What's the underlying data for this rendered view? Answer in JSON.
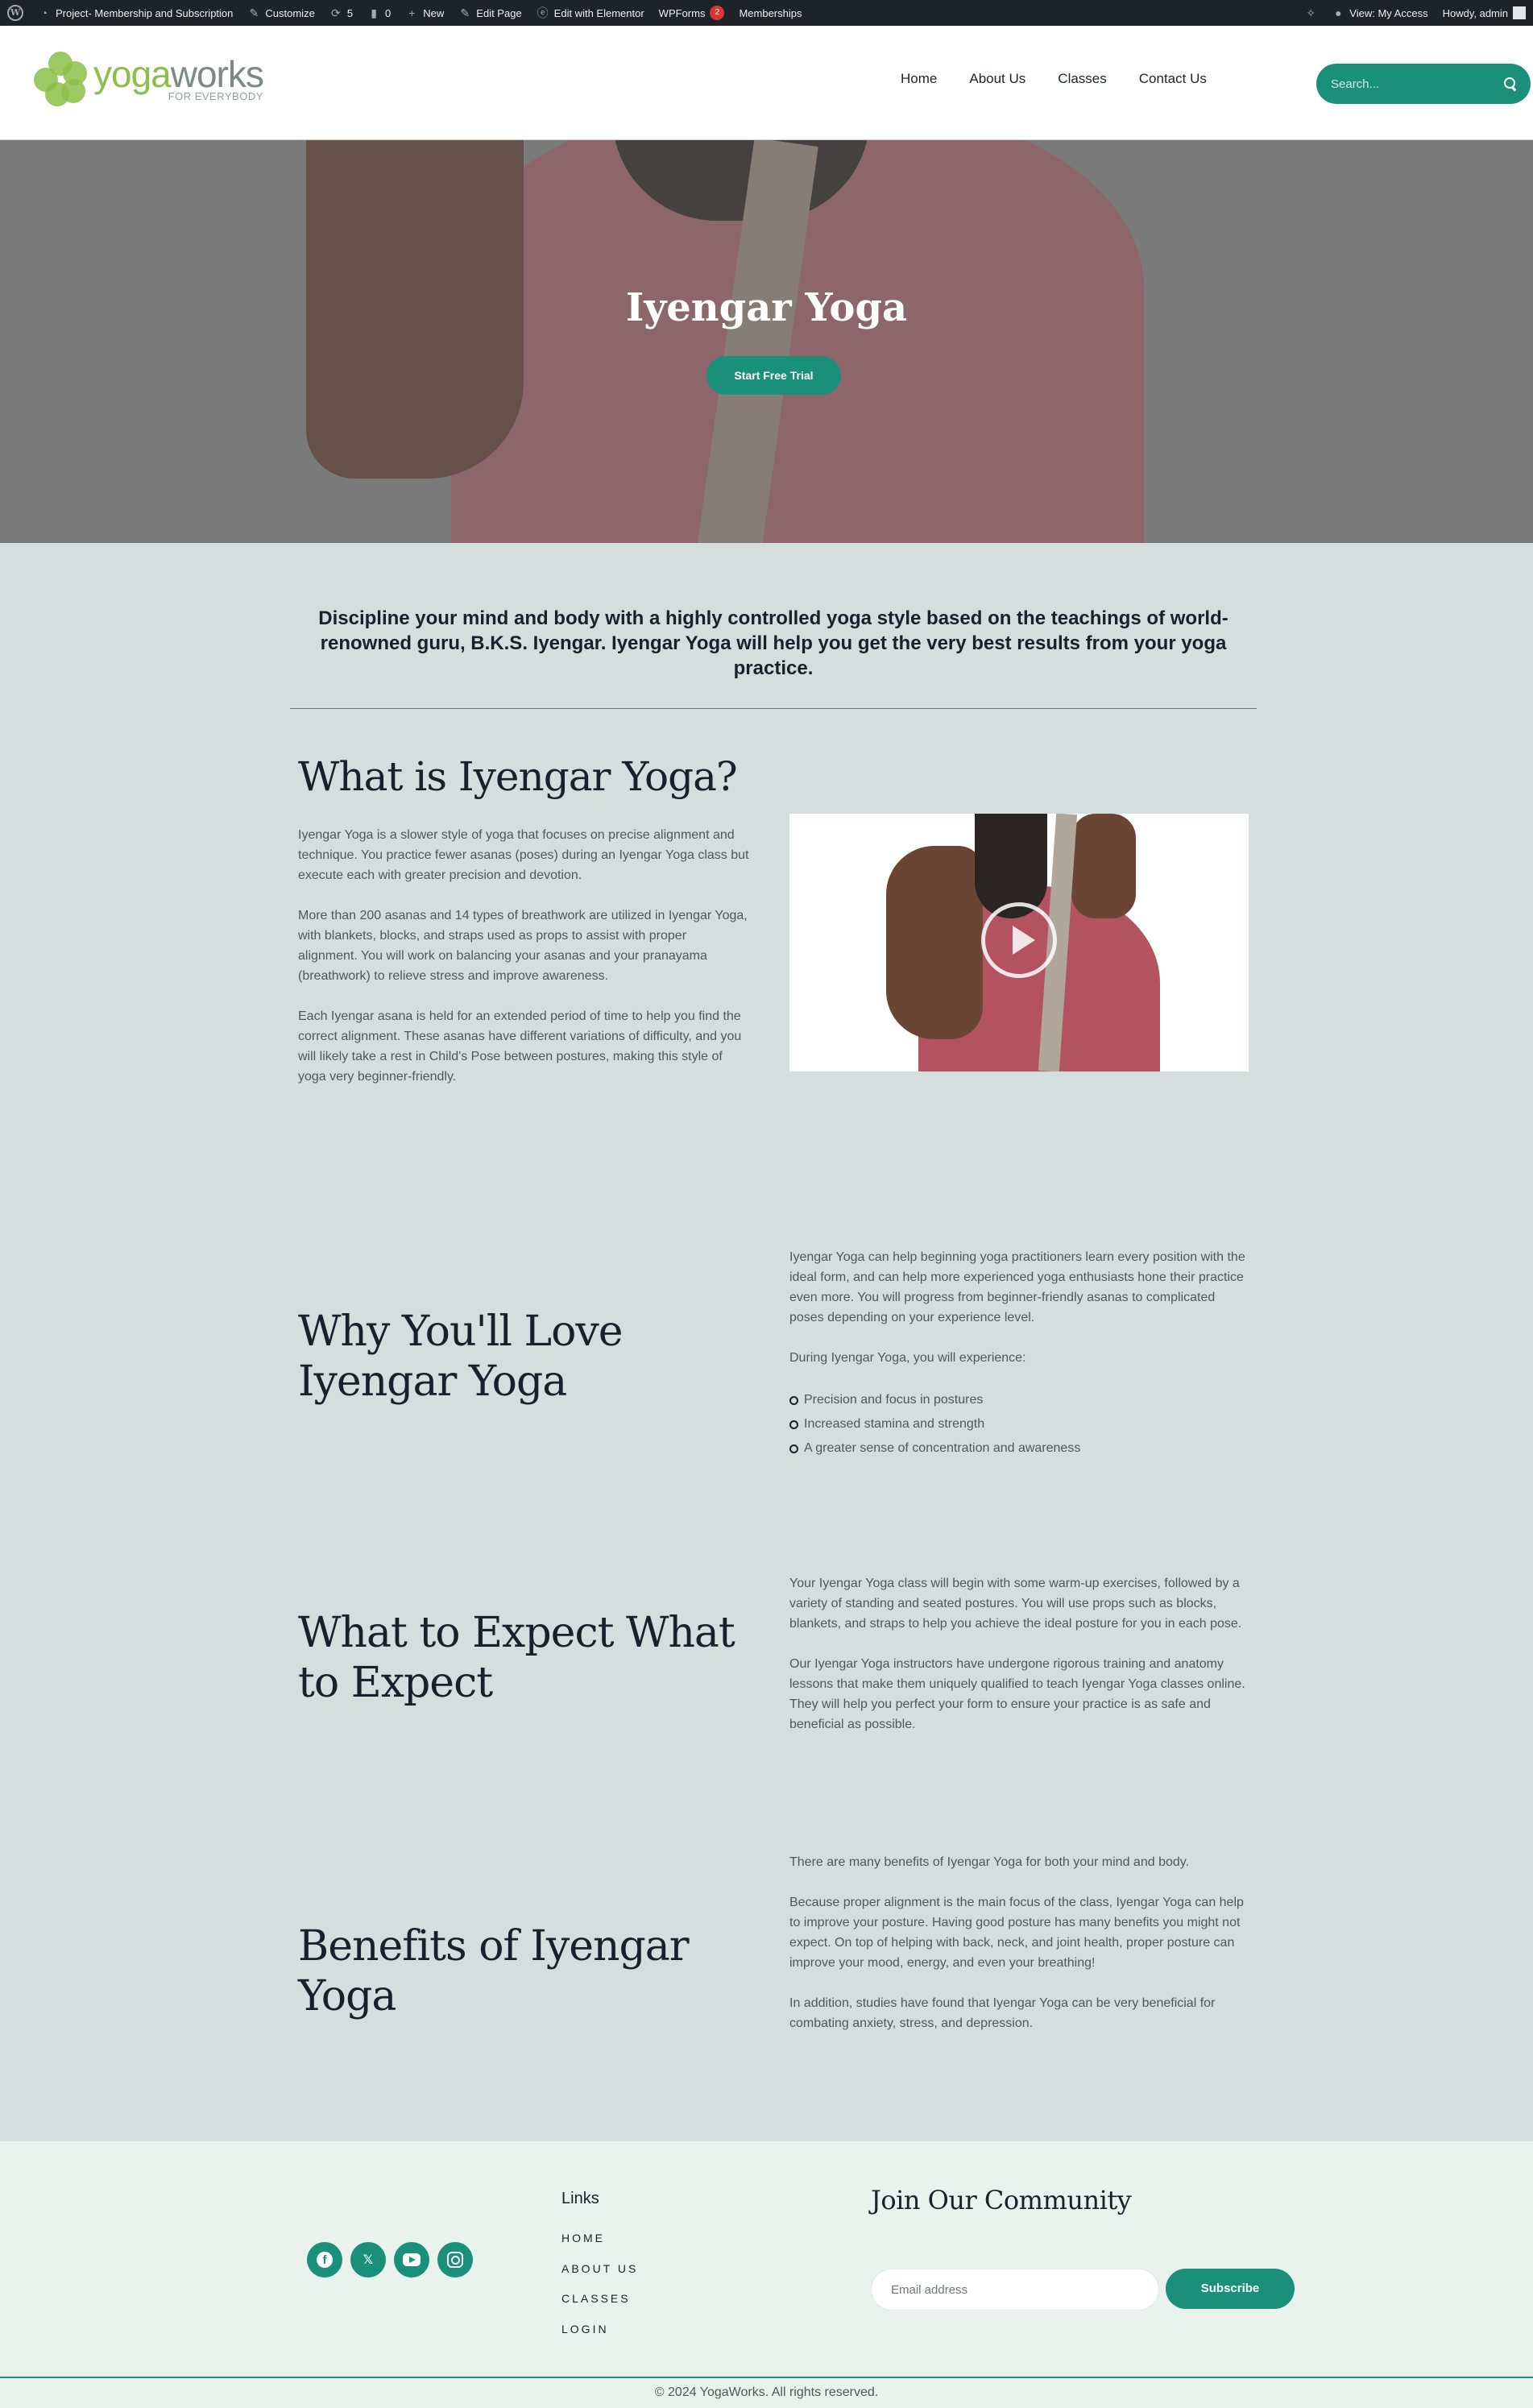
{
  "adminbar": {
    "site_name": "Project- Membership and Subscription",
    "customize": "Customize",
    "updates_count": "5",
    "comments_count": "0",
    "new": "New",
    "edit_page": "Edit Page",
    "edit_elementor": "Edit with Elementor",
    "wpforms": "WPForms",
    "wpforms_badge": "2",
    "memberships": "Memberships",
    "view_access": "View: My Access",
    "howdy": "Howdy, admin"
  },
  "header": {
    "logo_yoga": "yoga",
    "logo_works": "works",
    "logo_sub": "FOR EVERYBODY",
    "nav": [
      "Home",
      "About Us",
      "Classes",
      "Contact Us"
    ],
    "search_placeholder": "Search..."
  },
  "hero": {
    "title": "Iyengar Yoga",
    "cta": "Start Free Trial"
  },
  "intro": "Discipline your mind and body with a highly controlled yoga style based on the teachings of world-renowned guru, B.K.S. Iyengar. Iyengar Yoga will help you get the very best results from your yoga practice.",
  "what": {
    "title": "What is Iyengar Yoga?",
    "paragraphs": [
      "Iyengar Yoga is a slower style of yoga that focuses on precise alignment and technique. You practice fewer asanas (poses) during an Iyengar Yoga class but execute each with greater precision and devotion.",
      "More than 200 asanas and 14 types of breathwork are utilized in Iyengar Yoga, with blankets, blocks, and straps used as props to assist with proper alignment. You will work on balancing your asanas and your pranayama (breathwork) to relieve stress and improve awareness.",
      "Each Iyengar asana is held for an extended period of time to help you find the correct alignment. These asanas have different variations of difficulty, and you will likely take a rest in Child's Pose between postures, making this style of yoga very beginner-friendly."
    ]
  },
  "why": {
    "title": "Why You'll Love Iyengar Yoga",
    "paragraphs": [
      "Iyengar Yoga can help beginning yoga practitioners learn every position with the ideal form, and can help more experienced yoga enthusiasts hone their practice even more. You will progress from beginner-friendly asanas to complicated poses depending on your experience level.",
      "During Iyengar Yoga, you will experience:"
    ],
    "bullets": [
      "Precision and focus in postures",
      "Increased stamina and strength",
      "A greater sense of concentration and awareness"
    ]
  },
  "expect": {
    "title": "What to Expect What to Expect",
    "paragraphs": [
      "Your Iyengar Yoga class will begin with some warm-up exercises, followed by a variety of standing and seated postures. You will use props such as blocks, blankets, and straps to help you achieve the ideal posture for you in each pose.",
      "Our Iyengar Yoga instructors have undergone rigorous training and anatomy lessons that make them uniquely qualified to teach Iyengar Yoga classes online. They will help you perfect your form to ensure your practice is as safe and beneficial as possible."
    ]
  },
  "benefits": {
    "title": "Benefits of Iyengar Yoga",
    "paragraphs": [
      "There are many benefits of Iyengar Yoga for both your mind and body.",
      "Because proper alignment is the main focus of the class, Iyengar Yoga can help to improve your posture. Having good posture has many benefits you might not expect. On top of helping with back, neck, and joint health, proper posture can improve your mood, energy, and even your breathing!",
      "In addition, studies have found that Iyengar Yoga can be very beneficial for combating anxiety, stress, and depression."
    ]
  },
  "footer": {
    "socials": [
      "facebook-icon",
      "x-icon",
      "youtube-icon",
      "instagram-icon"
    ],
    "links_title": "Links",
    "links": [
      "HOME",
      "ABOUT US",
      "CLASSES",
      "LOGIN"
    ],
    "join_title": "Join Our Community",
    "email_placeholder": "Email address",
    "subscribe": "Subscribe",
    "copyright": "© 2024 YogaWorks. All rights reserved."
  },
  "colors": {
    "accent": "#1a8f7a",
    "page_bg": "#d5dedc",
    "footer_bg": "#eaf2ee",
    "adminbar_bg": "#1d2327",
    "logo_green": "#8cbf4a"
  }
}
